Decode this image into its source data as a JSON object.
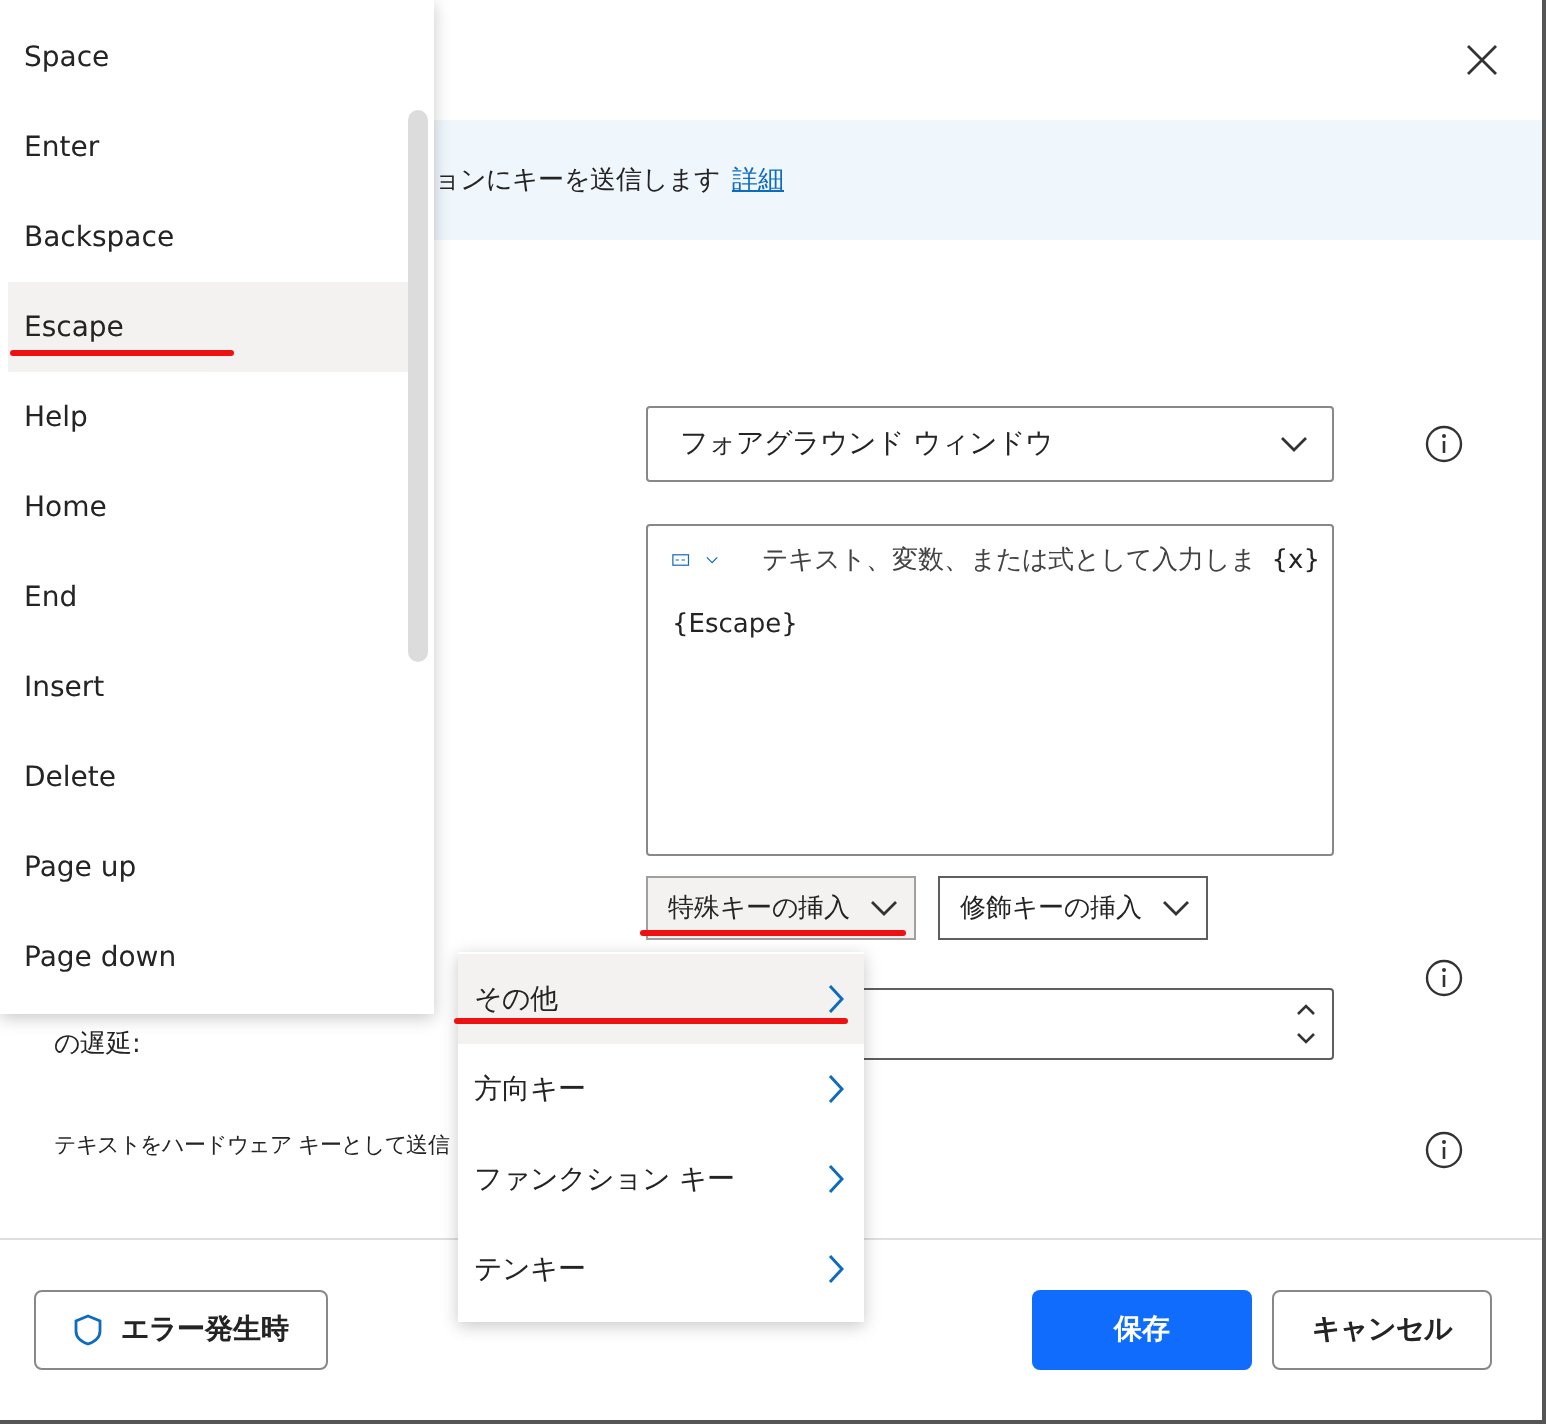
{
  "banner": {
    "text": "ョンにキーを送信します",
    "link": "詳細"
  },
  "window_select": {
    "value": "フォアグラウンド ウィンドウ"
  },
  "text_field": {
    "placeholder": "テキスト、変数、または式として入力しま",
    "variable_token": "{x}",
    "value": "{Escape}"
  },
  "insert_buttons": [
    {
      "label": "特殊キーの挿入",
      "active": true,
      "annotated": true
    },
    {
      "label": "修飾キーの挿入",
      "active": false,
      "annotated": false
    }
  ],
  "delay_label": "の遅延:",
  "hardware_label": "テキストをハードウェア キーとして送信",
  "footer": {
    "error_button": "エラー発生時",
    "save_button": "保存",
    "cancel_button": "キャンセル"
  },
  "key_menu": [
    {
      "label": "Space",
      "selected": false,
      "annotated": false
    },
    {
      "label": "Enter",
      "selected": false,
      "annotated": false
    },
    {
      "label": "Backspace",
      "selected": false,
      "annotated": false
    },
    {
      "label": "Escape",
      "selected": true,
      "annotated": true
    },
    {
      "label": "Help",
      "selected": false,
      "annotated": false
    },
    {
      "label": "Home",
      "selected": false,
      "annotated": false
    },
    {
      "label": "End",
      "selected": false,
      "annotated": false
    },
    {
      "label": "Insert",
      "selected": false,
      "annotated": false
    },
    {
      "label": "Delete",
      "selected": false,
      "annotated": false
    },
    {
      "label": "Page up",
      "selected": false,
      "annotated": false
    },
    {
      "label": "Page down",
      "selected": false,
      "annotated": false
    }
  ],
  "category_menu": [
    {
      "label": "その他",
      "selected": true,
      "annotated": true
    },
    {
      "label": "方向キー",
      "selected": false,
      "annotated": false
    },
    {
      "label": "ファンクション キー",
      "selected": false,
      "annotated": false
    },
    {
      "label": "テンキー",
      "selected": false,
      "annotated": false
    }
  ]
}
